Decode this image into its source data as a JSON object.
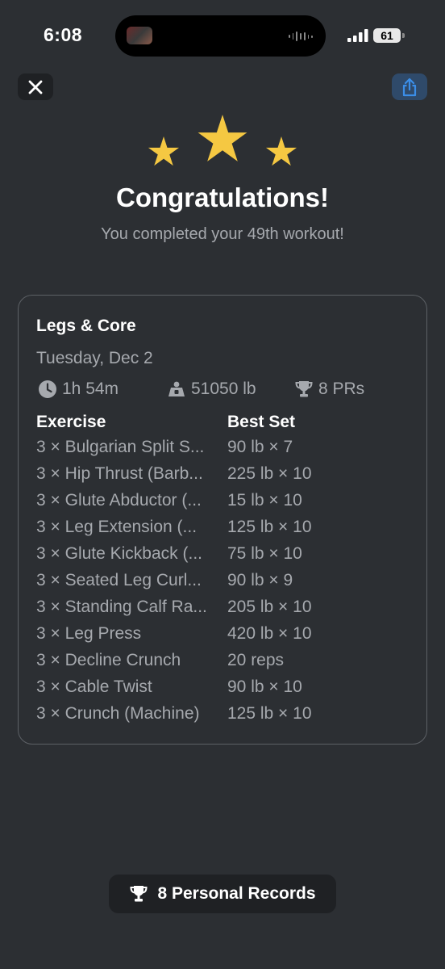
{
  "status_bar": {
    "time": "6:08",
    "battery": "61"
  },
  "header": {
    "title": "Congratulations!",
    "subtitle": "You completed your 49th workout!"
  },
  "workout": {
    "name": "Legs & Core",
    "date": "Tuesday, Dec 2",
    "duration": "1h 54m",
    "volume": "51050 lb",
    "prs": "8 PRs",
    "columns": {
      "exercise": "Exercise",
      "best_set": "Best Set"
    },
    "exercises": [
      {
        "name": "3 × Bulgarian Split S...",
        "best": "90 lb × 7"
      },
      {
        "name": "3 × Hip Thrust (Barb...",
        "best": "225 lb × 10"
      },
      {
        "name": "3 × Glute Abductor (...",
        "best": "15 lb × 10"
      },
      {
        "name": "3 × Leg Extension (...",
        "best": "125 lb × 10"
      },
      {
        "name": "3 × Glute Kickback (...",
        "best": "75 lb × 10"
      },
      {
        "name": "3 × Seated Leg Curl...",
        "best": "90 lb × 9"
      },
      {
        "name": "3 × Standing Calf Ra...",
        "best": "205 lb × 10"
      },
      {
        "name": "3 × Leg Press",
        "best": "420 lb × 10"
      },
      {
        "name": "3 × Decline Crunch",
        "best": "20 reps"
      },
      {
        "name": "3 × Cable Twist",
        "best": "90 lb × 10"
      },
      {
        "name": "3 × Crunch (Machine)",
        "best": "125 lb × 10"
      }
    ]
  },
  "personal_records_button": {
    "label": "8 Personal Records"
  },
  "icons": {
    "close": "close-icon",
    "share": "share-icon",
    "star": "star-icon",
    "clock": "clock-icon",
    "weight": "weight-icon",
    "trophy": "trophy-icon"
  },
  "colors": {
    "background": "#2c2f33",
    "star": "#f5c842",
    "accent": "#3b8ee8",
    "muted_text": "#a6a9ae"
  }
}
